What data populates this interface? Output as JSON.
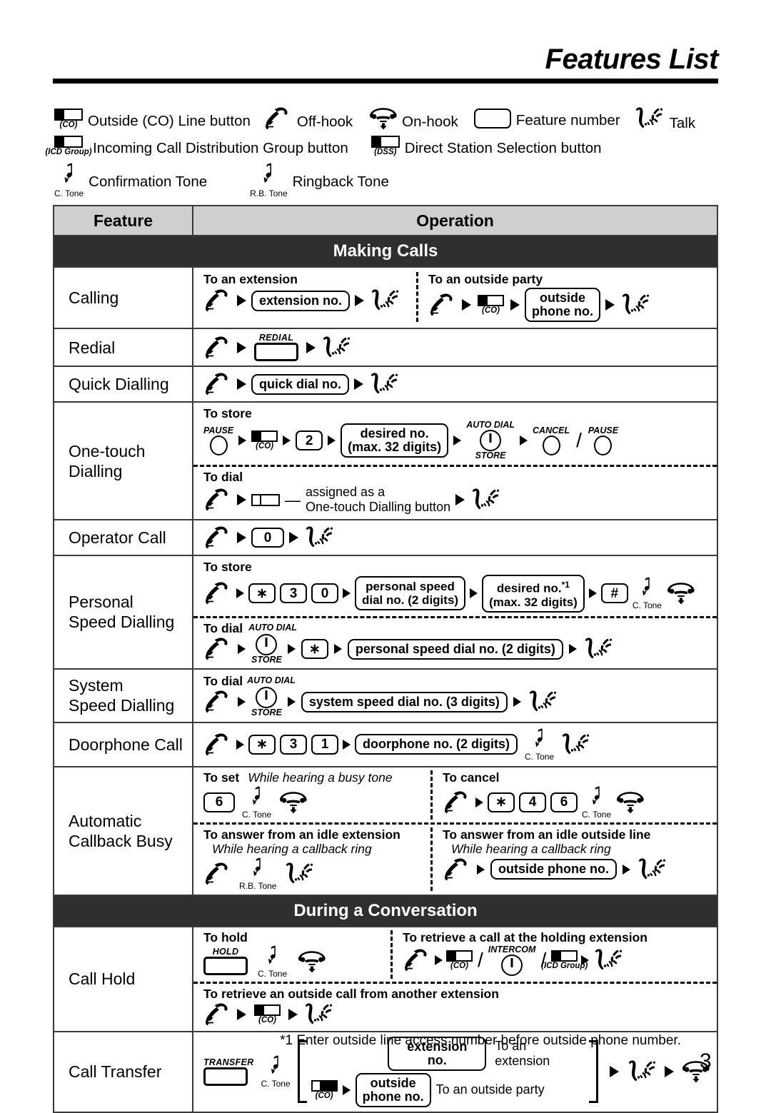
{
  "header": {
    "title": "Features List"
  },
  "legend": {
    "row1": [
      {
        "icon": "co-line-button-icon",
        "caption": "(CO)",
        "label": "Outside (CO) Line button"
      },
      {
        "icon": "off-hook-icon",
        "caption": "",
        "label": "Off-hook"
      },
      {
        "icon": "on-hook-icon",
        "caption": "",
        "label": "On-hook"
      },
      {
        "icon": "feature-number-key-icon",
        "caption": "",
        "label": "Feature number"
      },
      {
        "icon": "talk-icon",
        "caption": "",
        "label": "Talk"
      }
    ],
    "row2": [
      {
        "icon": "icd-group-button-icon",
        "caption": "(ICD Group)",
        "label": "Incoming Call Distribution Group button"
      },
      {
        "icon": "dss-button-icon",
        "caption": "(DSS)",
        "label": "Direct Station Selection button"
      }
    ],
    "row3": [
      {
        "icon": "confirmation-tone-icon",
        "caption": "C. Tone",
        "label": "Confirmation Tone"
      },
      {
        "icon": "ringback-tone-icon",
        "caption": "R.B. Tone",
        "label": "Ringback Tone"
      }
    ]
  },
  "table": {
    "headers": {
      "feature": "Feature",
      "operation": "Operation"
    },
    "sections": [
      {
        "title": "Making Calls"
      },
      {
        "title": "During a Conversation"
      }
    ],
    "rows": {
      "calling": {
        "feature": "Calling",
        "left_label": "To an extension",
        "left_pill": "extension no.",
        "right_label": "To an outside party",
        "right_co_caption": "(CO)",
        "right_pill_l1": "outside",
        "right_pill_l2": "phone no."
      },
      "redial": {
        "feature": "Redial",
        "key_caption": "REDIAL"
      },
      "quick_dialling": {
        "feature": "Quick Dialling",
        "pill": "quick dial no."
      },
      "one_touch": {
        "feature_l1": "One-touch",
        "feature_l2": "Dialling",
        "store_label": "To store",
        "pause_caption": "PAUSE",
        "co_caption": "(CO)",
        "key2": "2",
        "pill_l1": "desired no.",
        "pill_l2": "(max. 32 digits)",
        "autodial_top": "AUTO DIAL",
        "autodial_bottom": "STORE",
        "cancel_caption": "CANCEL",
        "pause2_caption": "PAUSE",
        "separator": "/",
        "dial_label": "To dial",
        "dash": "—",
        "assigned_l1": "assigned as a",
        "assigned_l2": "One-touch Dialling button"
      },
      "operator_call": {
        "feature": "Operator Call",
        "key0": "0"
      },
      "personal_speed": {
        "feature_l1": "Personal",
        "feature_l2": "Speed Dialling",
        "store_label": "To store",
        "key_star": "∗",
        "key3": "3",
        "key0": "0",
        "pill1_l1": "personal speed",
        "pill1_l2": "dial no. (2 digits)",
        "pill2_l1": "desired no.",
        "pill2_sup": "*1",
        "pill2_l2": "(max. 32 digits)",
        "key_hash": "#",
        "tone_caption": "C. Tone",
        "dial_label": "To dial",
        "autodial_top": "AUTO DIAL",
        "autodial_bottom": "STORE",
        "dial_star": "∗",
        "dial_pill": "personal speed dial no. (2 digits)"
      },
      "system_speed": {
        "feature_l1": "System",
        "feature_l2": "Speed Dialling",
        "dial_label": "To dial",
        "autodial_top": "AUTO DIAL",
        "autodial_bottom": "STORE",
        "pill": "system speed dial no. (3 digits)"
      },
      "doorphone": {
        "feature": "Doorphone Call",
        "key_star": "∗",
        "key3": "3",
        "key1": "1",
        "pill": "doorphone no. (2 digits)",
        "tone_caption": "C. Tone"
      },
      "auto_callback": {
        "feature_l1": "Automatic",
        "feature_l2": "Callback Busy",
        "set_label": "To set",
        "set_note": "While hearing a busy tone",
        "key6": "6",
        "set_tone_caption": "C. Tone",
        "cancel_label": "To cancel",
        "cancel_star": "∗",
        "cancel_key4": "4",
        "cancel_key6": "6",
        "cancel_tone_caption": "C. Tone",
        "ans_ext_label": "To answer from an idle extension",
        "ans_ext_note": "While hearing a callback ring",
        "ans_ext_tone_caption": "R.B. Tone",
        "ans_line_label": "To answer from an idle outside line",
        "ans_line_note": "While hearing a callback ring",
        "ans_line_pill": "outside phone no."
      },
      "call_hold": {
        "feature": "Call Hold",
        "hold_label": "To hold",
        "hold_key_caption": "HOLD",
        "hold_tone_caption": "C. Tone",
        "retrieve_label": "To retrieve a call at the holding extension",
        "co_caption": "(CO)",
        "intercom_caption": "INTERCOM",
        "icd_caption": "(ICD Group)",
        "sep1": "/",
        "sep2": "/",
        "retrieve2_label": "To retrieve an outside call from another extension",
        "retrieve2_co_caption": "(CO)"
      },
      "call_transfer": {
        "feature": "Call Transfer",
        "key_caption": "TRANSFER",
        "tone_caption": "C. Tone",
        "pill_ext": "extension no.",
        "note_ext": "To an extension",
        "co_caption": "(CO)",
        "pill_out_l1": "outside",
        "pill_out_l2": "phone no.",
        "note_out": "To an outside party"
      }
    }
  },
  "footnote": "*1 Enter outside line access number before outside phone number.",
  "page_number": "3"
}
